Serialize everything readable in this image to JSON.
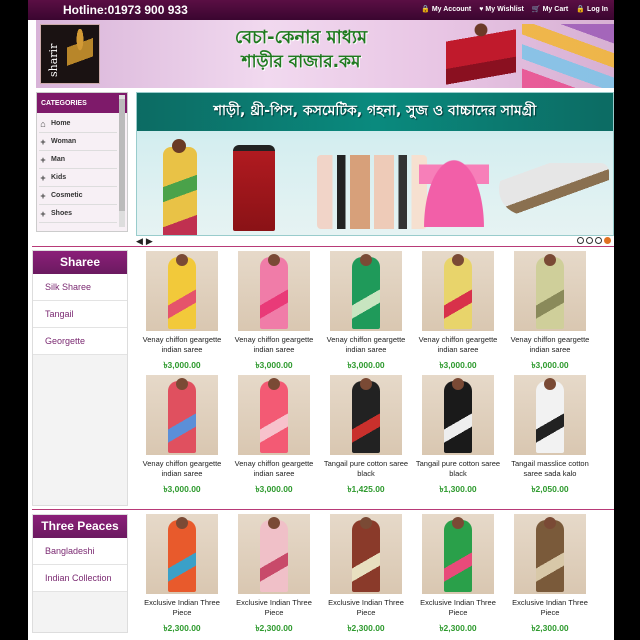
{
  "topbar": {
    "hotline": "Hotline:01973 900 933",
    "links": [
      {
        "icon": "lock-icon",
        "glyph": "🔒",
        "label": "My Account"
      },
      {
        "icon": "heart-icon",
        "glyph": "♥",
        "label": "My Wishlist"
      },
      {
        "icon": "cart-icon",
        "glyph": "🛒",
        "label": "My Cart"
      },
      {
        "icon": "login-icon",
        "glyph": "🔒",
        "label": "Log In"
      }
    ]
  },
  "banner": {
    "logo_text": "sharir",
    "title_line1": "বেচা-কেনার মাধ্যম",
    "title_line2": "শাড়ীর বাজার.কম"
  },
  "categories": {
    "heading": "CATEGORIES",
    "items": [
      {
        "icon": "home-icon",
        "glyph": "⌂",
        "label": "Home"
      },
      {
        "icon": "plus-icon",
        "glyph": "+",
        "label": "Woman"
      },
      {
        "icon": "plus-icon",
        "glyph": "+",
        "label": "Man"
      },
      {
        "icon": "plus-icon",
        "glyph": "+",
        "label": "Kids"
      },
      {
        "icon": "plus-icon",
        "glyph": "+",
        "label": "Cosmetic"
      },
      {
        "icon": "plus-icon",
        "glyph": "+",
        "label": "Shoes"
      }
    ]
  },
  "slider": {
    "caption": "শাড়ী, থ্রী-পিস, কসমেটিক, গহনা, সুজ ও বাচ্চাদের সামগ্রী",
    "prev": "◀",
    "next": "▶",
    "dots": 4,
    "active_dot": 3
  },
  "sections": [
    {
      "heading": "Sharee",
      "links": [
        "Silk Sharee",
        "Tangail",
        "Georgette"
      ],
      "products": [
        {
          "name": "Venay chiffon geargette indian saree",
          "price": "৳3,000.00",
          "color": "#f2c93a",
          "accent": "#e5536b"
        },
        {
          "name": "Venay chiffon geargette indian saree",
          "price": "৳3,000.00",
          "color": "#f07ca8",
          "accent": "#e93a78"
        },
        {
          "name": "Venay chiffon geargette indian saree",
          "price": "৳3,000.00",
          "color": "#1f9a5a",
          "accent": "#c8e5c0"
        },
        {
          "name": "Venay chiffon geargette indian saree",
          "price": "৳3,000.00",
          "color": "#e8d46b",
          "accent": "#d8314a"
        },
        {
          "name": "Venay chiffon geargette indian saree",
          "price": "৳3,000.00",
          "color": "#cfcf9a",
          "accent": "#8a8a5a"
        },
        {
          "name": "Venay chiffon geargette indian saree",
          "price": "৳3,000.00",
          "color": "#e0505f",
          "accent": "#5b8fd8"
        },
        {
          "name": "Venay chiffon geargette indian saree",
          "price": "৳3,000.00",
          "color": "#f35a74",
          "accent": "#f7c2cc"
        },
        {
          "name": "Tangail pure cotton saree black",
          "price": "৳1,425.00",
          "color": "#222222",
          "accent": "#c9302c"
        },
        {
          "name": "Tangail pure cotton saree black",
          "price": "৳1,300.00",
          "color": "#1a1a1a",
          "accent": "#eeeeee"
        },
        {
          "name": "Tangail masslice cotton saree sada kalo",
          "price": "৳2,050.00",
          "color": "#f2f2f2",
          "accent": "#222222"
        }
      ]
    },
    {
      "heading": "Three Peaces",
      "links": [
        "Bangladeshi",
        "Indian Collection"
      ],
      "products": [
        {
          "name": "Exclusive Indian Three Piece",
          "price": "৳2,300.00",
          "color": "#e85a2c",
          "accent": "#3aa0c8"
        },
        {
          "name": "Exclusive Indian Three Piece",
          "price": "৳2,300.00",
          "color": "#f0c0c8",
          "accent": "#c84a6a"
        },
        {
          "name": "Exclusive Indian Three Piece",
          "price": "৳2,300.00",
          "color": "#8a3a2a",
          "accent": "#e8e0c0"
        },
        {
          "name": "Exclusive Indian Three Piece",
          "price": "৳2,300.00",
          "color": "#2aa04a",
          "accent": "#e84a7a"
        },
        {
          "name": "Exclusive Indian Three Piece",
          "price": "৳2,300.00",
          "color": "#7a5a3a",
          "accent": "#d8c8a8"
        }
      ]
    }
  ]
}
